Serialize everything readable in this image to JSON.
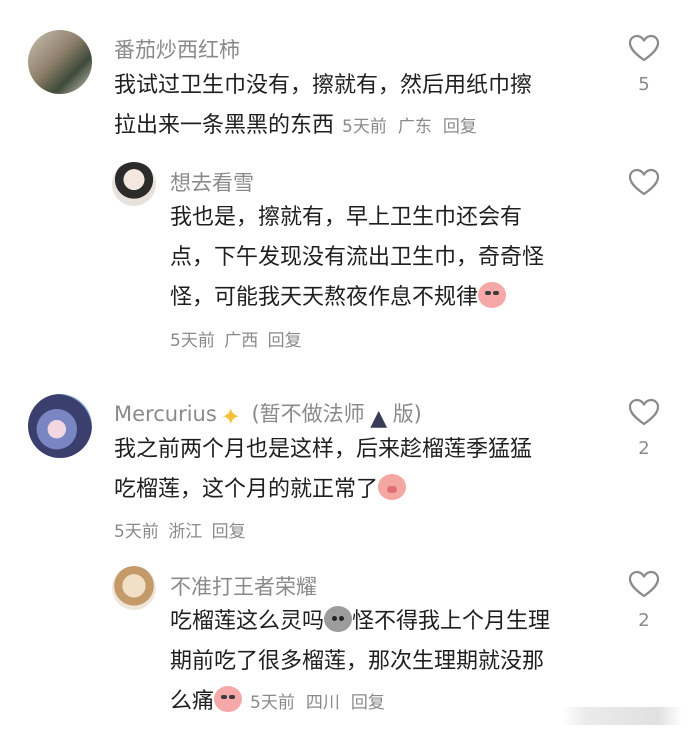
{
  "comments": [
    {
      "username": "番茄炒西红柿",
      "text_line1": "我试过卫生巾没有，擦就有，然后用纸巾擦",
      "text_line2": "拉出来一条黑黑的东西",
      "time": "5天前",
      "location": "广东",
      "reply_label": "回复",
      "likes": "5"
    },
    {
      "username": "想去看雪",
      "text_line1": "我也是，擦就有，早上卫生巾还会有",
      "text_line2": "点，下午发现没有流出卫生巾，奇奇怪",
      "text_line3": "怪，可能我天天熬夜作息不规律",
      "time": "5天前",
      "location": "广西",
      "reply_label": "回复",
      "likes": ""
    },
    {
      "username": "Mercurius",
      "username_suffix_1": "(暂不做法师",
      "username_suffix_2": "版)",
      "text_line1": "我之前两个月也是这样，后来趁榴莲季猛猛",
      "text_line2": "吃榴莲，这个月的就正常了",
      "time": "5天前",
      "location": "浙江",
      "reply_label": "回复",
      "likes": "2"
    },
    {
      "username": "不准打王者荣耀",
      "text_line1a": "吃榴莲这么灵吗",
      "text_line1b": "怪不得我上个月生理",
      "text_line2": "期前吃了很多榴莲，那次生理期就没那",
      "text_line3": "么痛",
      "time": "5天前",
      "location": "四川",
      "reply_label": "回复",
      "likes": "2"
    }
  ],
  "icons": {
    "like": "heart-outline-icon",
    "emoji_cry": "crying-face-emoji",
    "emoji_pig": "pig-face-emoji",
    "emoji_rock": "rock-face-emoji",
    "emoji_star": "sparkle-star-emoji",
    "emoji_witch": "witch-emoji"
  },
  "colors": {
    "username": "#8a8a8a",
    "text": "#1f1f1f",
    "meta": "#8a8a8a"
  }
}
